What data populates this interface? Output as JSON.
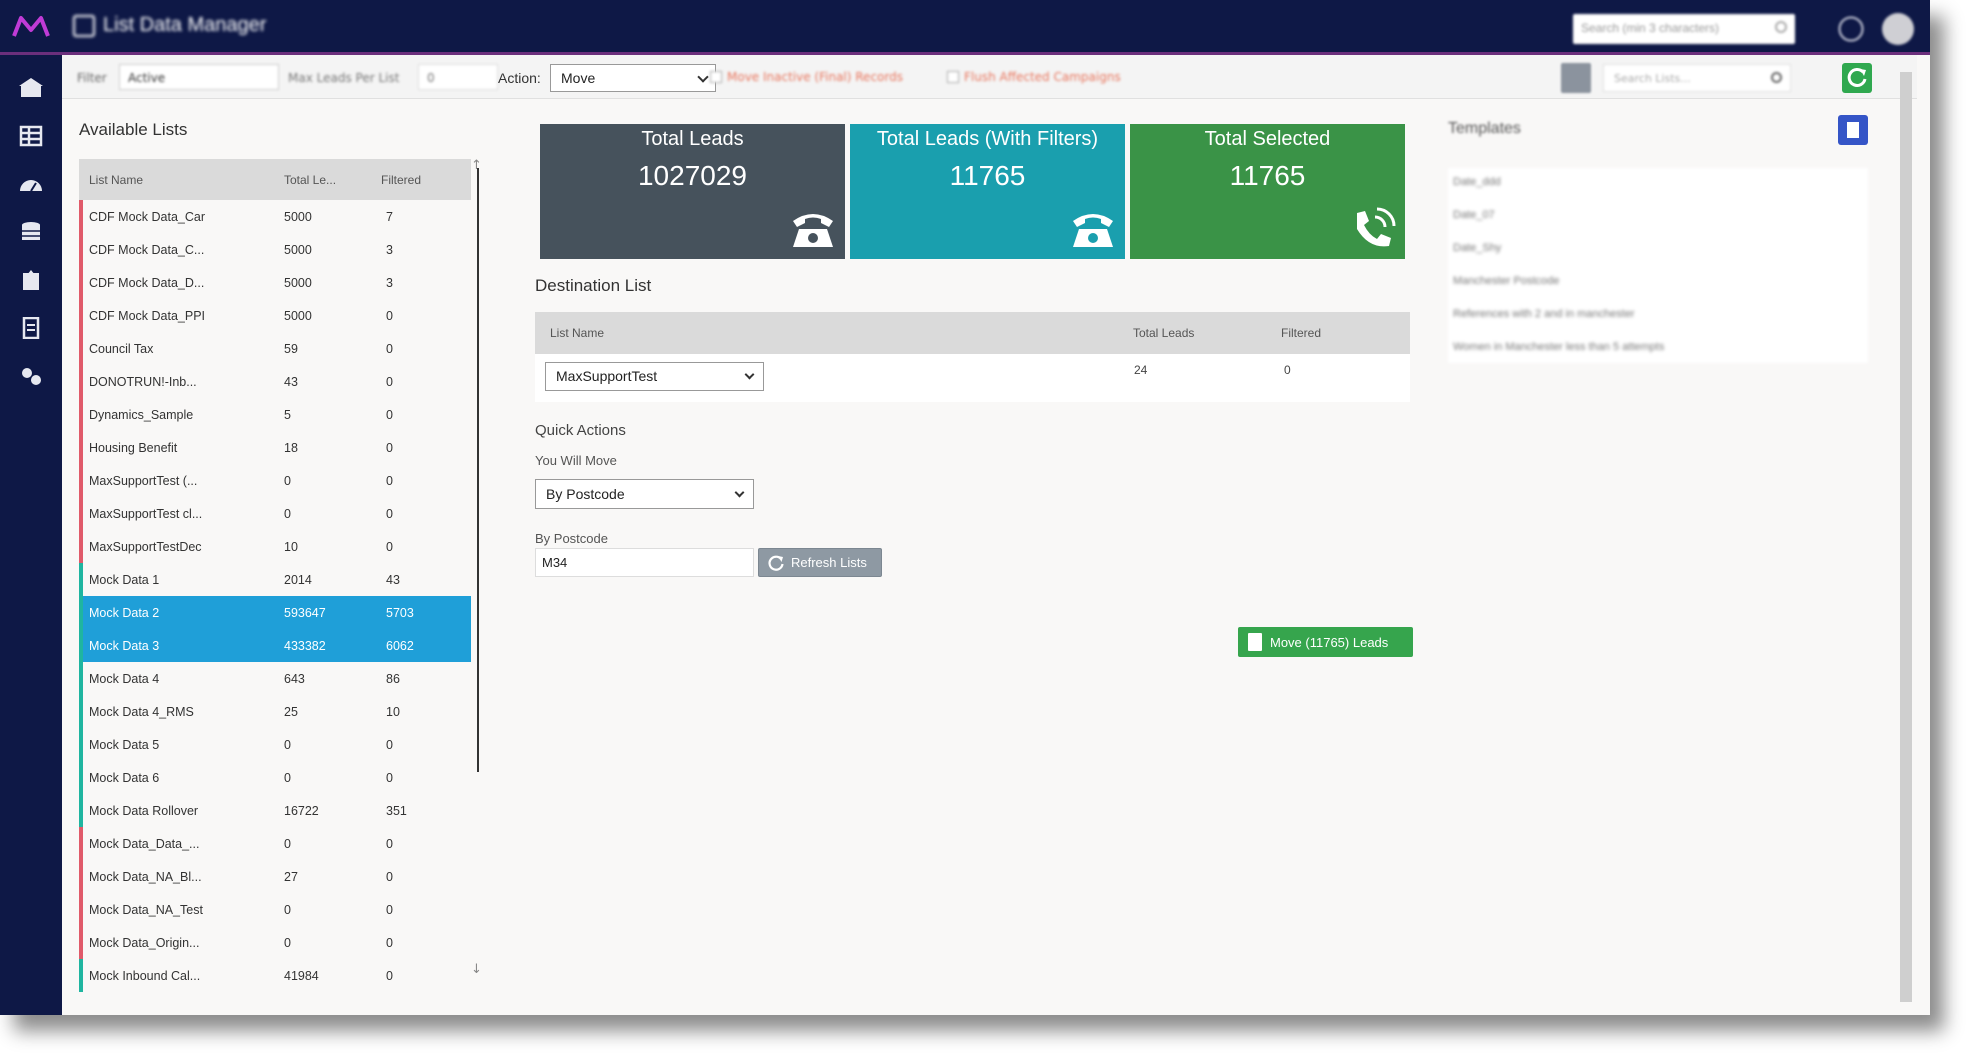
{
  "app": {
    "title": "List Data Manager",
    "search_placeholder": "Search (min 3 characters)"
  },
  "toolbar": {
    "filter_label": "Filter",
    "filter_value": "Active",
    "max_leads_label": "Max Leads Per List",
    "max_leads_value": "0",
    "action_label": "Action:",
    "action_value": "Move",
    "move_inactive_label": "Move Inactive (Final) Records",
    "flush_campaigns_label": "Flush Affected Campaigns",
    "search_lists_placeholder": "Search Lists..."
  },
  "available_lists": {
    "title": "Available Lists",
    "columns": [
      "List Name",
      "Total Le...",
      "Filtered"
    ],
    "rows": [
      {
        "name": "CDF Mock Data_Car",
        "total": "5000",
        "filtered": "7",
        "status": "red",
        "selected": false
      },
      {
        "name": "CDF Mock Data_C...",
        "total": "5000",
        "filtered": "3",
        "status": "red",
        "selected": false
      },
      {
        "name": "CDF Mock Data_D...",
        "total": "5000",
        "filtered": "3",
        "status": "red",
        "selected": false
      },
      {
        "name": "CDF Mock Data_PPI",
        "total": "5000",
        "filtered": "0",
        "status": "red",
        "selected": false
      },
      {
        "name": "Council Tax",
        "total": "59",
        "filtered": "0",
        "status": "red",
        "selected": false
      },
      {
        "name": "DONOTRUN!-Inb...",
        "total": "43",
        "filtered": "0",
        "status": "red",
        "selected": false
      },
      {
        "name": "Dynamics_Sample",
        "total": "5",
        "filtered": "0",
        "status": "red",
        "selected": false
      },
      {
        "name": "Housing Benefit",
        "total": "18",
        "filtered": "0",
        "status": "red",
        "selected": false
      },
      {
        "name": "MaxSupportTest (...",
        "total": "0",
        "filtered": "0",
        "status": "red",
        "selected": false
      },
      {
        "name": "MaxSupportTest cl...",
        "total": "0",
        "filtered": "0",
        "status": "red",
        "selected": false
      },
      {
        "name": "MaxSupportTestDec",
        "total": "10",
        "filtered": "0",
        "status": "red",
        "selected": false
      },
      {
        "name": "Mock Data 1",
        "total": "2014",
        "filtered": "43",
        "status": "teal",
        "selected": false
      },
      {
        "name": "Mock Data 2",
        "total": "593647",
        "filtered": "5703",
        "status": "teal",
        "selected": true
      },
      {
        "name": "Mock Data 3",
        "total": "433382",
        "filtered": "6062",
        "status": "teal",
        "selected": true
      },
      {
        "name": "Mock Data 4",
        "total": "643",
        "filtered": "86",
        "status": "teal",
        "selected": false
      },
      {
        "name": "Mock Data 4_RMS",
        "total": "25",
        "filtered": "10",
        "status": "teal",
        "selected": false
      },
      {
        "name": "Mock Data 5",
        "total": "0",
        "filtered": "0",
        "status": "teal",
        "selected": false
      },
      {
        "name": "Mock Data 6",
        "total": "0",
        "filtered": "0",
        "status": "teal",
        "selected": false
      },
      {
        "name": "Mock Data Rollover",
        "total": "16722",
        "filtered": "351",
        "status": "teal",
        "selected": false
      },
      {
        "name": "Mock Data_Data_...",
        "total": "0",
        "filtered": "0",
        "status": "red",
        "selected": false
      },
      {
        "name": "Mock Data_NA_Bl...",
        "total": "27",
        "filtered": "0",
        "status": "red",
        "selected": false
      },
      {
        "name": "Mock Data_NA_Test",
        "total": "0",
        "filtered": "0",
        "status": "red",
        "selected": false
      },
      {
        "name": "Mock Data_Origin...",
        "total": "0",
        "filtered": "0",
        "status": "red",
        "selected": false
      },
      {
        "name": "Mock Inbound Cal...",
        "total": "41984",
        "filtered": "0",
        "status": "teal",
        "selected": false
      }
    ]
  },
  "cards": {
    "total_leads": {
      "title": "Total Leads",
      "value": "1027029"
    },
    "total_filtered": {
      "title": "Total Leads (With Filters)",
      "value": "11765"
    },
    "total_selected": {
      "title": "Total Selected",
      "value": "11765"
    }
  },
  "destination": {
    "title": "Destination List",
    "col_name": "List Name",
    "col_total": "Total Leads",
    "col_filtered": "Filtered",
    "selected_list": "MaxSupportTest",
    "total": "24",
    "filtered": "0"
  },
  "quick_actions": {
    "title": "Quick Actions",
    "move_label": "You Will Move",
    "move_value": "By Postcode",
    "postcode_label": "By Postcode",
    "postcode_value": "M34",
    "refresh_label": "Refresh Lists",
    "move_button_label": "Move (11765) Leads"
  },
  "templates": {
    "title": "Templates",
    "items": [
      "Date_ddd",
      "Date_07",
      "Date_Shy",
      "Manchester Postcode",
      "References with 2 and in manchester",
      "Women in Manchester less than 5 attempts"
    ]
  },
  "colors": {
    "navy": "#0e1846",
    "status_red": "#e05a6a",
    "status_teal": "#1fb5a0",
    "selected_row": "#1f9fd8"
  }
}
